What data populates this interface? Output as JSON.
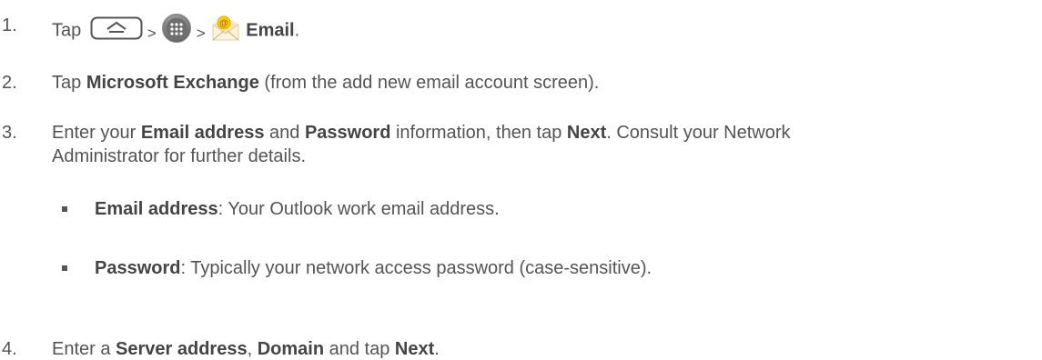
{
  "steps": [
    {
      "number": "1.",
      "tap": "Tap",
      "sep1": ">",
      "sep2": ">",
      "email_label": "Email",
      "period": ".",
      "icons": [
        "home-key-icon",
        "apps-icon",
        "email-app-icon"
      ]
    },
    {
      "number": "2.",
      "pre": "Tap ",
      "bold": "Microsoft Exchange",
      "post": " (from the add new email account screen)."
    },
    {
      "number": "3.",
      "t1": "Enter your ",
      "b1": "Email address",
      "t2": " and ",
      "b2": "Password",
      "t3": " information, then tap ",
      "b3": "Next",
      "t4": ". Consult your Network",
      "line2": "Administrator for further details."
    },
    {
      "number": "4.",
      "t1": "Enter a ",
      "b1": "Server address",
      "t2": ", ",
      "b2": "Domain",
      "t3": " and tap ",
      "b3": "Next",
      "t4": "."
    }
  ],
  "bullets": [
    {
      "term": "Email address",
      "desc": ": Your Outlook work email address."
    },
    {
      "term": "Password",
      "desc": ": Typically your network access password (case-sensitive)."
    }
  ]
}
